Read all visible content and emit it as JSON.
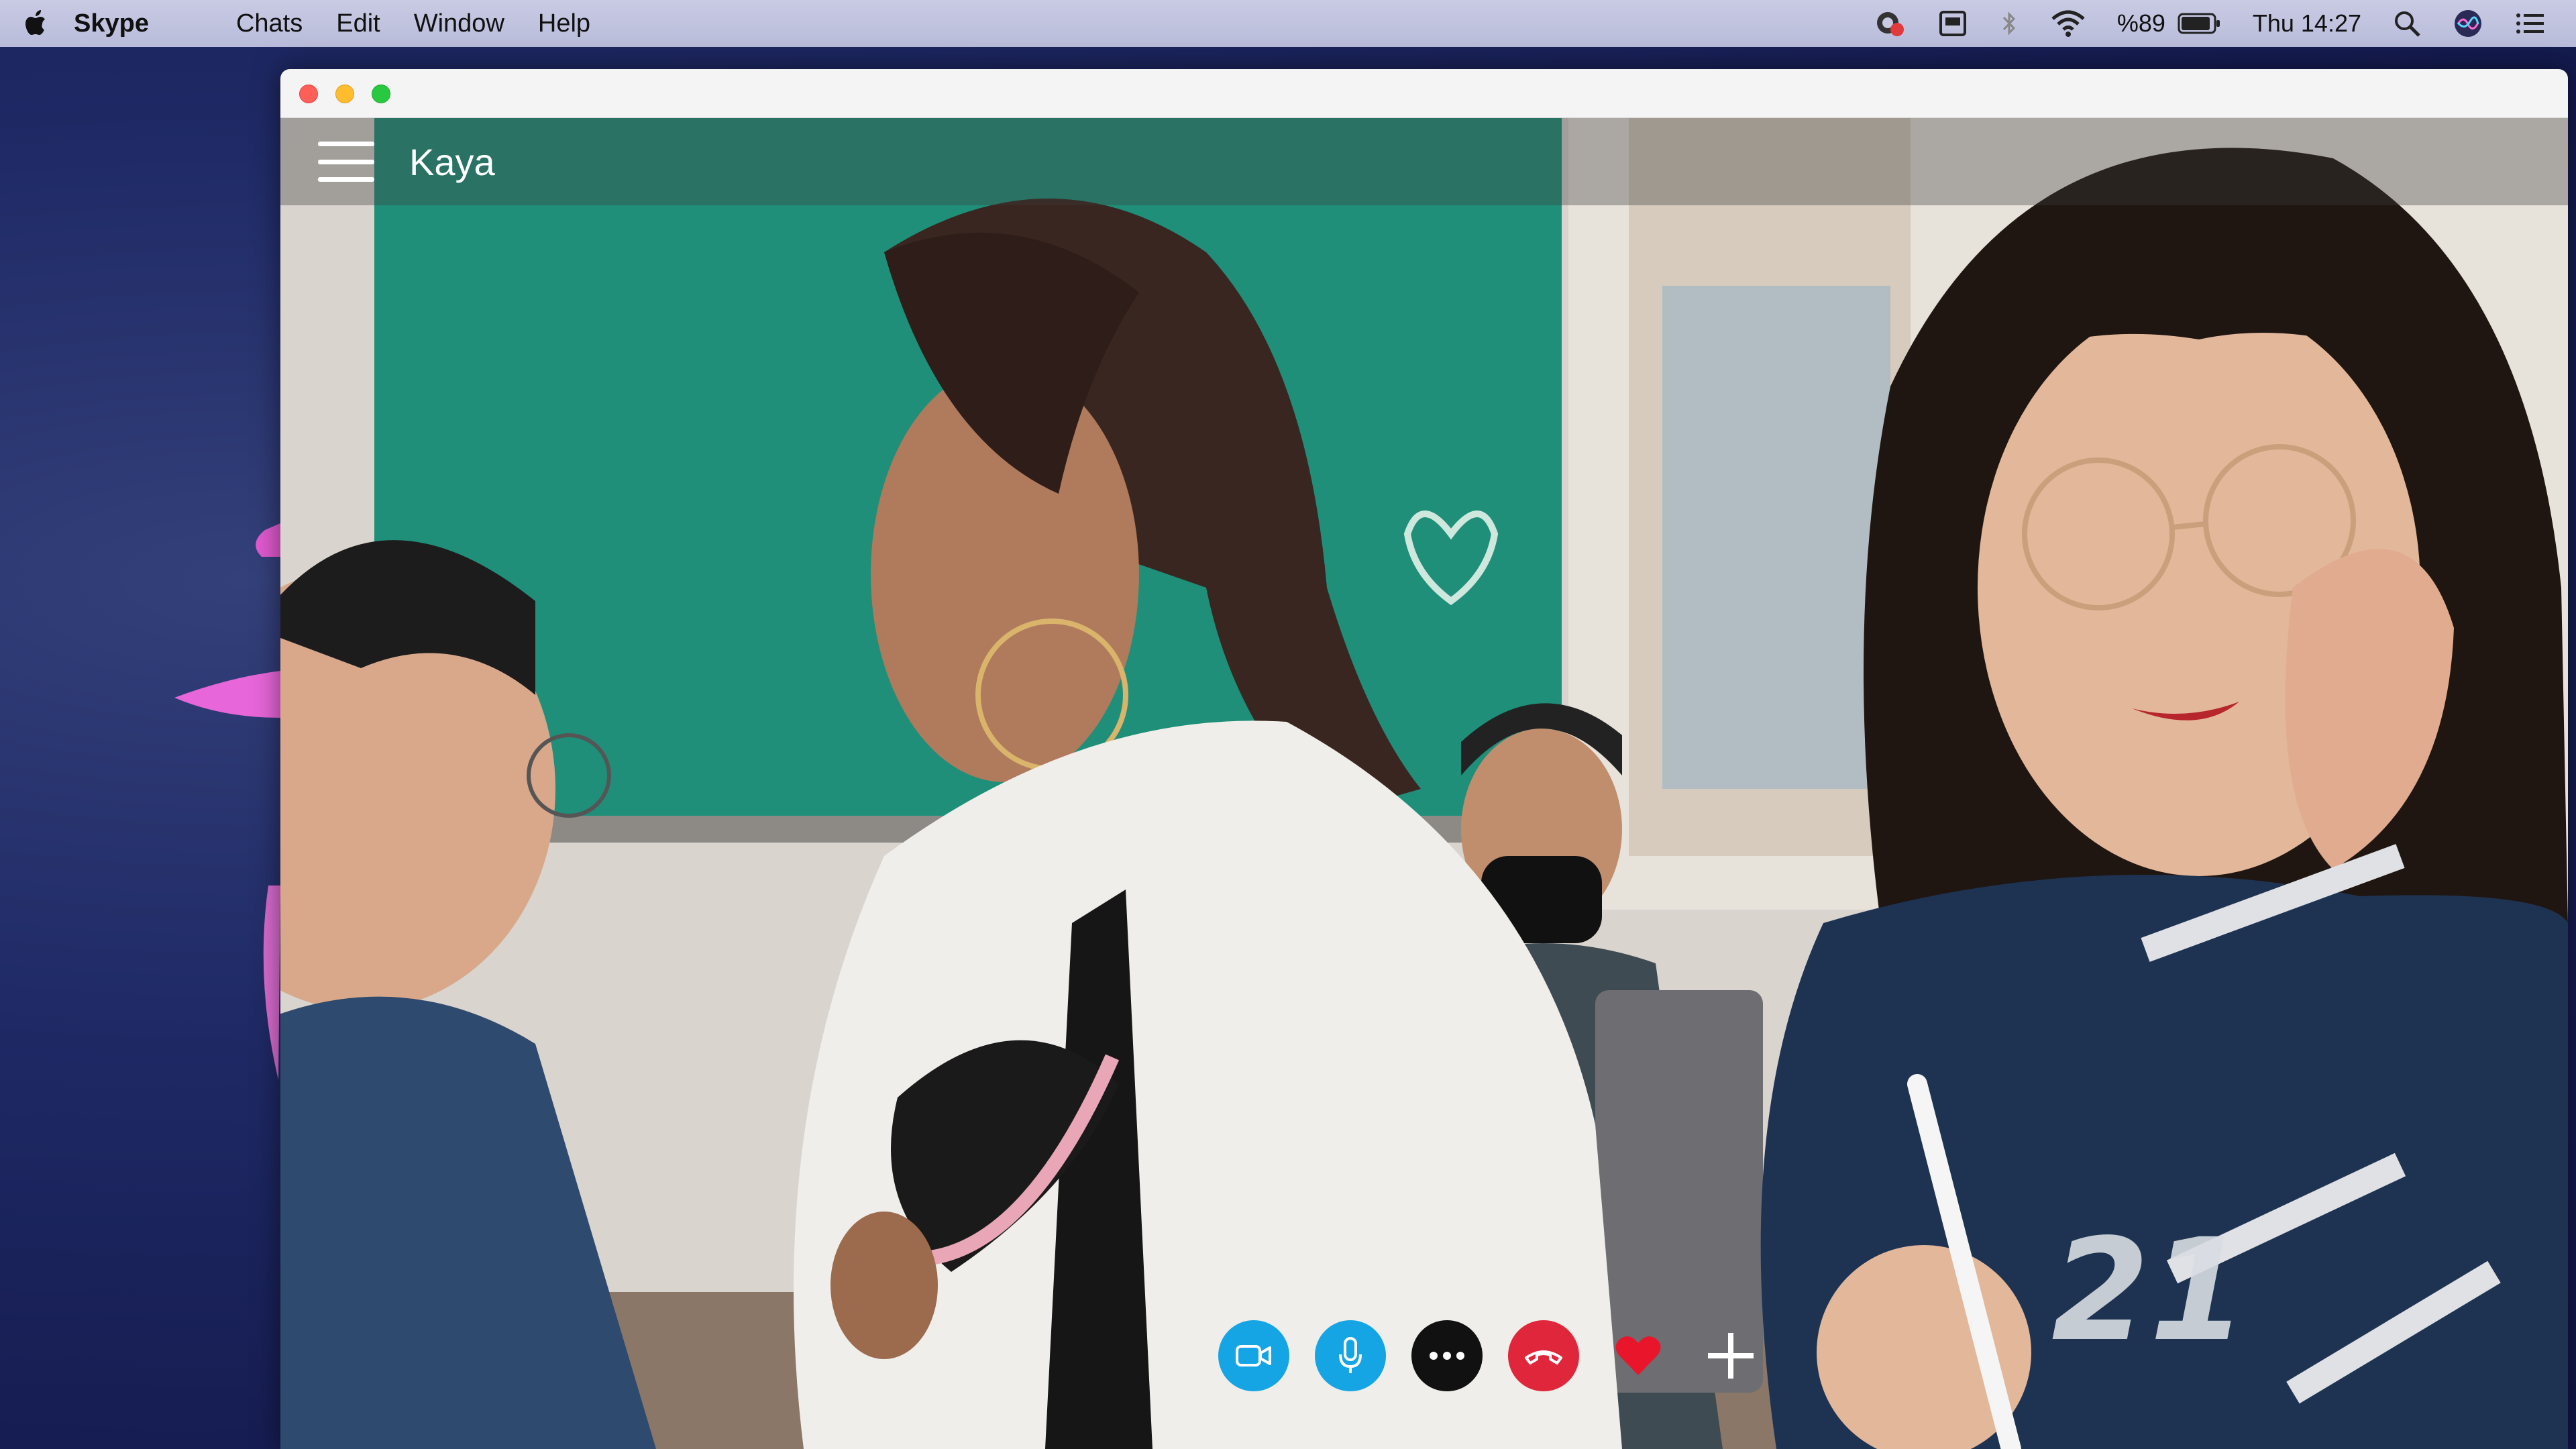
{
  "menubar": {
    "app_name": "Skype",
    "items": [
      {
        "label": "Chats"
      },
      {
        "label": "Edit"
      },
      {
        "label": "Window"
      },
      {
        "label": "Help"
      }
    ],
    "status": {
      "battery_percent": "%89",
      "clock": "Thu 14:27"
    }
  },
  "call": {
    "contact_name": "Kaya",
    "controls": {
      "video": "video-camera-icon",
      "mic": "microphone-icon",
      "more": "more-options-icon",
      "end": "end-call-icon",
      "heart": "heart-icon",
      "add": "plus-icon"
    }
  },
  "colors": {
    "skype_blue": "#16a5e4",
    "end_call_red": "#e0263a",
    "heart_red": "#e8152b"
  }
}
